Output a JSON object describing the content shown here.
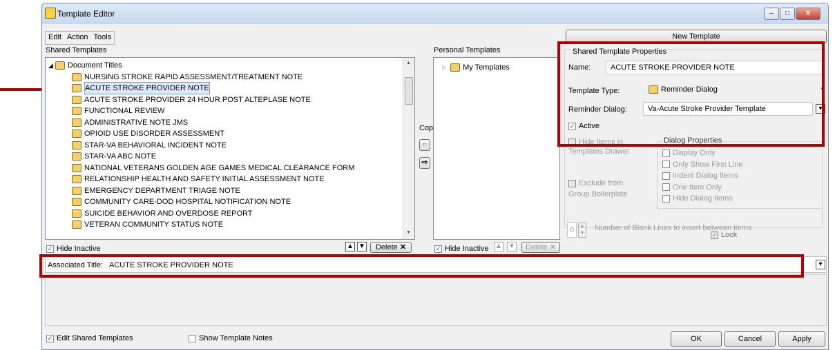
{
  "window": {
    "title": "Template Editor",
    "min_label": "–",
    "max_label": "□",
    "close_label": "X"
  },
  "menu": [
    "Edit",
    "Action",
    "Tools"
  ],
  "shared": {
    "heading": "Shared Templates",
    "root": "Document Titles",
    "items": [
      "NURSING STROKE RAPID ASSESSMENT/TREATMENT NOTE",
      "ACUTE STROKE PROVIDER NOTE",
      "ACUTE STROKE PROVIDER 24 HOUR POST ALTEPLASE NOTE",
      "FUNCTIONAL REVIEW",
      "ADMINISTRATIVE NOTE JMS",
      "OPIOID USE DISORDER ASSESSMENT",
      "STAR-VA BEHAVIORAL INCIDENT NOTE",
      "STAR-VA ABC NOTE",
      "NATIONAL VETERANS GOLDEN AGE GAMES MEDICAL CLEARANCE FORM",
      "RELATIONSHIP HEALTH AND SAFETY INITIAL ASSESSMENT NOTE",
      "EMERGENCY DEPARTMENT TRIAGE NOTE",
      "COMMUNITY CARE-DOD HOSPITAL NOTIFICATION NOTE",
      "SUICIDE BEHAVIOR AND OVERDOSE REPORT",
      "VETERAN COMMUNITY STATUS NOTE"
    ],
    "hide_inactive": "Hide Inactive",
    "delete": "Delete"
  },
  "copy_label": "Copy",
  "personal": {
    "heading": "Personal Templates",
    "root": "My Templates",
    "hide_inactive": "Hide Inactive",
    "delete": "Delete"
  },
  "new_template": "New Template",
  "properties": {
    "heading": "Shared Template Properties",
    "name_label": "Name:",
    "name_value": "ACUTE STROKE PROVIDER NOTE",
    "type_label": "Template Type:",
    "type_value": "Reminder Dialog",
    "dialog_label": "Reminder Dialog:",
    "dialog_value": "Va-Acute Stroke Provider Template",
    "active": "Active",
    "hide_items": "Hide Items in Templates Drawer",
    "exclude": "Exclude from Group Boilerplate",
    "dialog_props_heading": "Dialog Properties",
    "dialog_props": [
      "Display Only",
      "Only Show First Line",
      "Indent Dialog Items",
      "One Item Only",
      "Hide Dialog Items"
    ],
    "blank_lines_value": "0",
    "blank_lines_label": "Number of Blank Lines to insert between items",
    "lock": "Lock"
  },
  "associated": {
    "label": "Associated Title:",
    "value": "ACUTE STROKE PROVIDER NOTE"
  },
  "footer": {
    "edit_shared": "Edit Shared Templates",
    "show_notes": "Show Template Notes",
    "ok": "OK",
    "cancel": "Cancel",
    "apply": "Apply"
  },
  "colors": {
    "highlight_red": "#b30000"
  }
}
